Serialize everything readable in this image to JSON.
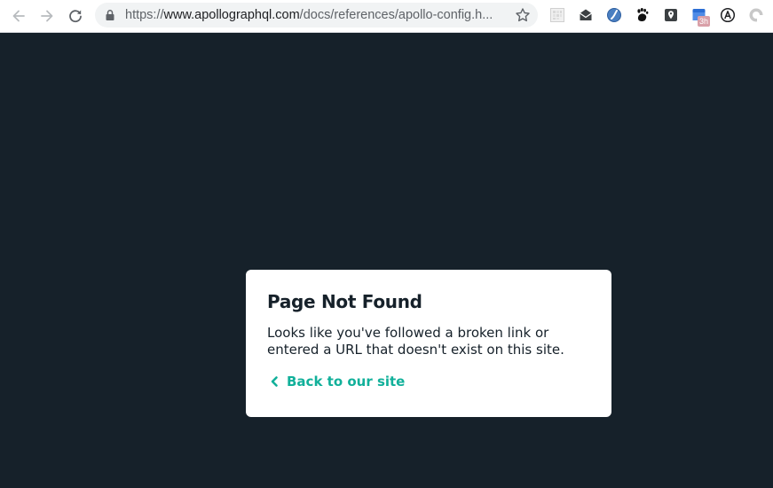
{
  "browser": {
    "url": {
      "scheme": "https://",
      "host": "www.apollographql.com",
      "path": "/docs/references/apollo-config.h..."
    },
    "extensions": [
      {
        "icon": "grid-extension-icon"
      },
      {
        "icon": "mail-extension-icon"
      },
      {
        "icon": "blue-swirl-extension-icon"
      },
      {
        "icon": "gnome-foot-extension-icon"
      },
      {
        "icon": "location-pin-extension-icon"
      },
      {
        "icon": "calendar-extension-icon",
        "badge": "3h"
      },
      {
        "icon": "circled-a-extension-icon"
      },
      {
        "icon": "gray-circle-extension-icon"
      }
    ]
  },
  "error_card": {
    "title": "Page Not Found",
    "message": "Looks like you've followed a broken link or entered a URL that doesn't exist on this site.",
    "back_link": "Back to our site"
  },
  "colors": {
    "page_background": "#16212a",
    "accent": "#11b09a",
    "card_background": "#ffffff"
  }
}
